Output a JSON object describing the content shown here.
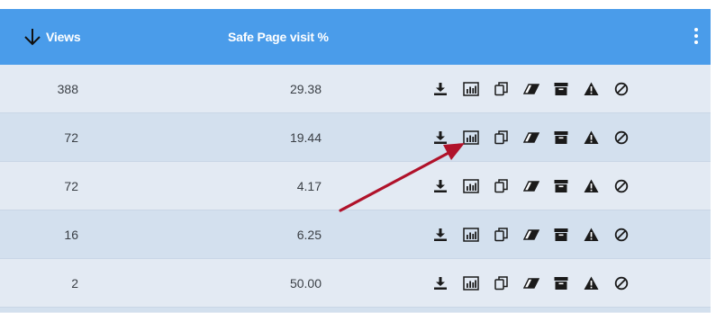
{
  "header": {
    "views_label": "Views",
    "safe_page_label": "Safe Page visit %",
    "sort_icon": "arrow-down-icon",
    "menu_icon": "kebab-menu-icon"
  },
  "rows": [
    {
      "views": "388",
      "safe_page_pct": "29.38"
    },
    {
      "views": "72",
      "safe_page_pct": "19.44"
    },
    {
      "views": "72",
      "safe_page_pct": "4.17"
    },
    {
      "views": "16",
      "safe_page_pct": "6.25"
    },
    {
      "views": "2",
      "safe_page_pct": "50.00"
    }
  ],
  "row_actions": [
    "download-icon",
    "bar-chart-icon",
    "copy-icon",
    "eraser-icon",
    "archive-icon",
    "warning-icon",
    "block-icon"
  ],
  "colors": {
    "header_bg": "#4a9cea",
    "row_bg": "#e3eaf3",
    "row_alt_bg": "#d3e0ee",
    "annotation_arrow": "#b0122a"
  }
}
